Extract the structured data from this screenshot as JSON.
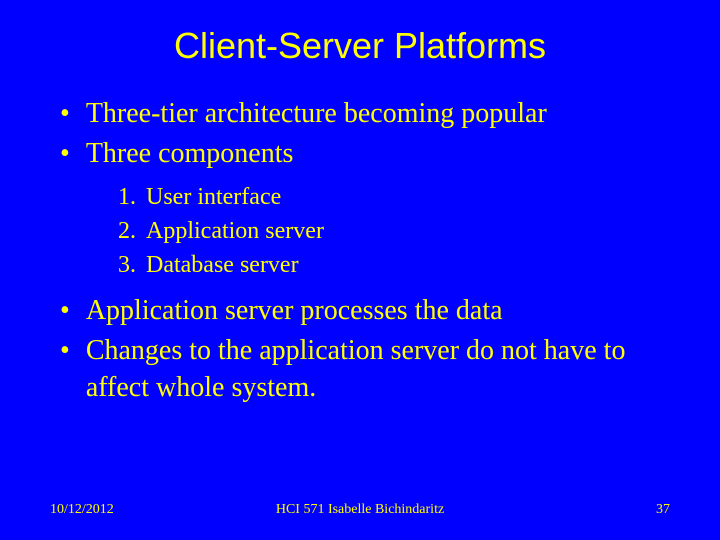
{
  "slide": {
    "title": "Client-Server Platforms",
    "bullets": [
      "Three-tier architecture becoming popular",
      "Three components"
    ],
    "numbered": [
      "User interface",
      "Application server",
      "Database server"
    ],
    "bullets2": [
      "Application server processes the data",
      "Changes to the application server do not have to affect whole system."
    ]
  },
  "footer": {
    "date": "10/12/2012",
    "center": "HCI 571   Isabelle Bichindaritz",
    "page": "37"
  }
}
